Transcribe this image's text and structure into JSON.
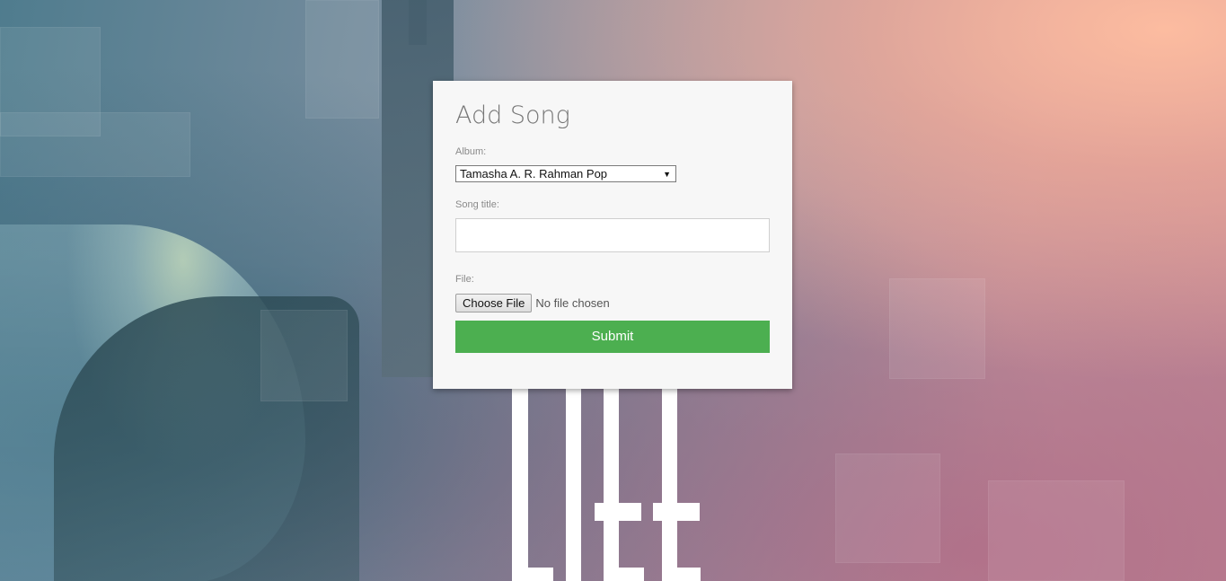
{
  "form": {
    "title": "Add Song",
    "album_label": "Album:",
    "album_selected": "Tamasha A. R. Rahman Pop",
    "song_title_label": "Song title:",
    "song_title_value": "",
    "file_label": "File:",
    "file_button_label": "Choose File",
    "file_status": "No file chosen",
    "submit_label": "Submit"
  },
  "colors": {
    "card_background": "#f7f7f7",
    "submit_button": "#4caf50",
    "title_text": "#777777"
  },
  "icons": {
    "select_caret": "triangle-down-icon"
  }
}
